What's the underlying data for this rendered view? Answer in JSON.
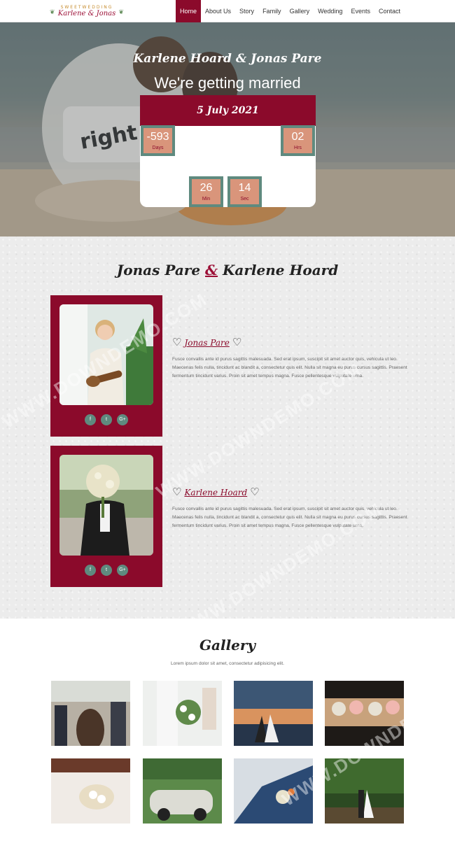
{
  "logo": {
    "top": "SWEETWEDDING",
    "name": "Karlene & Jonas"
  },
  "nav": {
    "items": [
      "Home",
      "About Us",
      "Story",
      "Family",
      "Gallery",
      "Wedding",
      "Events",
      "Contact"
    ]
  },
  "hero": {
    "names": "Karlene Hoard & Jonas Pare",
    "subtitle": "We're getting married",
    "date": "5 July 2021",
    "countdown": [
      {
        "value": "-593",
        "unit": "Days"
      },
      {
        "value": "02",
        "unit": "Hrs"
      },
      {
        "value": "26",
        "unit": "Min"
      },
      {
        "value": "14",
        "unit": "Sec"
      }
    ]
  },
  "couple": {
    "title_left": "Jonas Pare",
    "title_amp": "&",
    "title_right": "Karlene Hoard",
    "people": [
      {
        "name": "Jonas Pare",
        "bio": "Fusce convallis ante id purus sagittis malesuada. Sed erat ipsum, suscipit sit amet auctor quis, vehicula ut leo. Maecenas felis nulla, tincidunt ac blandit a, consectetur quis elit. Nulla sit magna eu purus cursus sagittis. Praesent fermentum tincidunt varius. Proin sit amet tempus magna. Fusce pellentesque vulputate urna.",
        "social": [
          "f",
          "t",
          "G+"
        ]
      },
      {
        "name": "Karlene Hoard",
        "bio": "Fusce convallis ante id purus sagittis malesuada. Sed erat ipsum, suscipit sit amet auctor quis, vehicula ut leo. Maecenas felis nulla, tincidunt ac blandit a, consectetur quis elit. Nulla sit magna eu purus cursus sagittis. Praesent fermentum tincidunt varius. Proin sit amet tempus magna. Fusce pellentesque vulputate urna.",
        "social": [
          "f",
          "t",
          "G+"
        ]
      }
    ]
  },
  "gallery": {
    "title": "Gallery",
    "subtitle": "Lorem ipsum dolor sit amet, consectetur adipisicing elit."
  },
  "watermark": {
    "text": "WWW.DOWNDEMO.COM"
  },
  "colors": {
    "accent": "#8b0a2b",
    "teal": "#5f8a7f",
    "peach": "#d9957b"
  }
}
